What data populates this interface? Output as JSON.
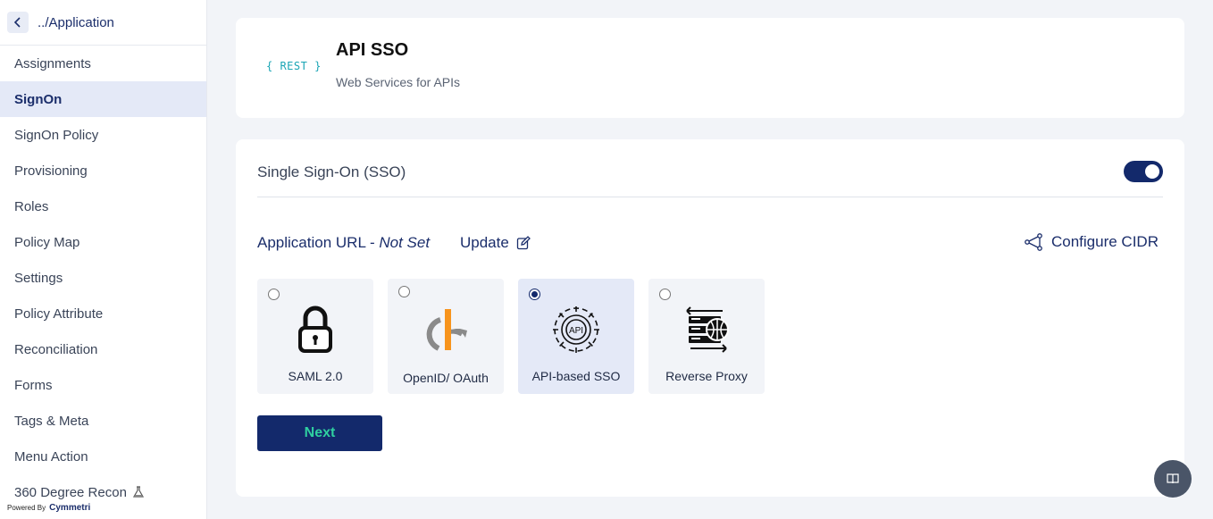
{
  "sidebar": {
    "back_label": "../Application",
    "items": [
      {
        "label": "Assignments"
      },
      {
        "label": "SignOn"
      },
      {
        "label": "SignOn Policy"
      },
      {
        "label": "Provisioning"
      },
      {
        "label": "Roles"
      },
      {
        "label": "Policy Map"
      },
      {
        "label": "Settings"
      },
      {
        "label": "Policy Attribute"
      },
      {
        "label": "Reconciliation"
      },
      {
        "label": "Forms"
      },
      {
        "label": "Tags & Meta"
      },
      {
        "label": "Menu Action"
      },
      {
        "label": "360 Degree Recon"
      }
    ],
    "active_item": "SignOn",
    "powered_by": "Powered By",
    "brand": "Cymmetri"
  },
  "header": {
    "logo_text": "{ REST }",
    "title": "API SSO",
    "subtitle": "Web Services for APIs"
  },
  "sso": {
    "title": "Single Sign-On (SSO)",
    "enabled": true,
    "app_url_label": "Application URL - ",
    "app_url_value": "Not Set",
    "update_label": "Update",
    "cidr_label": "Configure CIDR",
    "options": [
      {
        "label": "SAML 2.0",
        "icon": "lock-icon",
        "selected": false
      },
      {
        "label": "OpenID/ OAuth",
        "icon": "openid-icon",
        "selected": false
      },
      {
        "label": "API-based SSO",
        "icon": "api-gear-icon",
        "selected": true
      },
      {
        "label": "Reverse Proxy",
        "icon": "reverse-proxy-icon",
        "selected": false
      }
    ],
    "next_label": "Next"
  },
  "colors": {
    "primary": "#13296b",
    "next_text": "#2fd0a0",
    "active_bg": "#e4e9f7"
  }
}
